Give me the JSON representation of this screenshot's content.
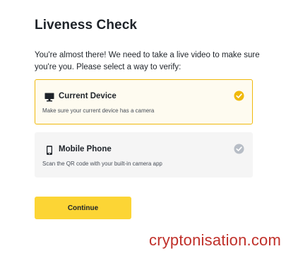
{
  "header": {
    "title": "Liveness Check",
    "intro": "You're almost there! We need to take a live video to make sure you're you. Please select a way to verify:"
  },
  "options": [
    {
      "label": "Current Device",
      "description": "Make sure your current device has a camera",
      "icon": "monitor-icon",
      "selected": true
    },
    {
      "label": "Mobile Phone",
      "description": "Scan the QR code with your built-in camera app",
      "icon": "mobile-phone-icon",
      "selected": false
    }
  ],
  "actions": {
    "continue_label": "Continue"
  },
  "watermark": "cryptonisation.com",
  "colors": {
    "accent": "#fcd535",
    "accent_border": "#f0b90b",
    "selected_bg": "#fefbf0",
    "unselected_bg": "#f5f5f5",
    "check_inactive": "#b7bdc6",
    "watermark": "#c0302a"
  }
}
